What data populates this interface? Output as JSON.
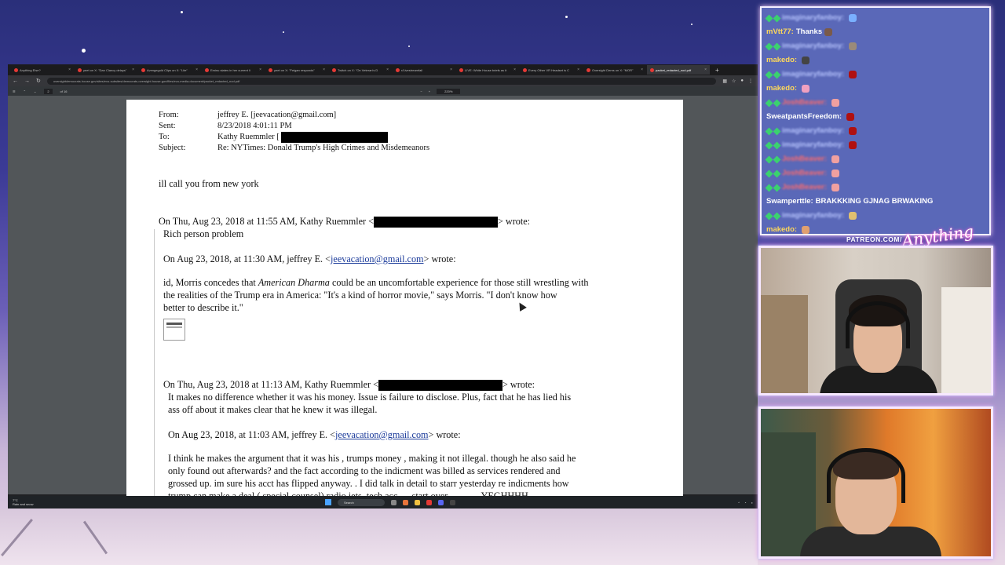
{
  "browser": {
    "tabs": [
      {
        "label": "Anything Else?",
        "active": false
      },
      {
        "label": "yeet on X: \"Dan Clancy delays\"",
        "active": false
      },
      {
        "label": "Avengegold Clips on X: \"Lite\"",
        "active": false
      },
      {
        "label": "Eminu states in her current li",
        "active": false
      },
      {
        "label": "yeet on X: \"Feigan responds\"",
        "active": false
      },
      {
        "label": "Twitch on X: \"On Veteran's D",
        "active": false
      },
      {
        "label": "r/Livestreamfail",
        "active": false
      },
      {
        "label": "LIVE: White House briefs as it",
        "active": false
      },
      {
        "label": "Every Other VR Headset is C",
        "active": false
      },
      {
        "label": "Oversight Dems on X: \"MOR\"",
        "active": false
      },
      {
        "label": "packet_redacted_nod.pdf",
        "active": true
      }
    ],
    "url": "oversightdemocrats.house.gov/sites/evo-subsites/democrats-oversight.house.gov/files/evo-media-document/packet_redacted_nod.pdf",
    "pdf_toolbar": {
      "page_current": "2",
      "page_total": "of 16",
      "zoom": "220%"
    }
  },
  "document": {
    "header": {
      "from_label": "From:",
      "from_value": "jeffrey E. [jeevacation@gmail.com]",
      "sent_label": "Sent:",
      "sent_value": "8/23/2018 4:01:11 PM",
      "to_label": "To:",
      "to_value": "Kathy Ruemmler [",
      "subject_label": "Subject:",
      "subject_value": "Re: NYTimes: Donald Trump's High Crimes and Misdemeanors"
    },
    "body_line": "ill call you from new york",
    "reply1": {
      "intro": "On Thu, Aug 23, 2018 at 11:55 AM, Kathy Ruemmler <",
      "wrote": "> wrote:",
      "text": "Rich person problem"
    },
    "reply2": {
      "intro": "On Aug 23, 2018, at 11:30 AM, jeffrey E. <",
      "email": "jeevacation@gmail.com",
      "wrote": "> wrote:",
      "line1_a": "id, Morris concedes that ",
      "line1_em": "American Dharma",
      "line1_b": " could be an uncomfortable experience for those still wrestling with",
      "line2": "the realities of the Trump era in America: \"It's a kind of horror movie,\" says Morris. \"I don't know how",
      "line3": "better to describe it.\""
    },
    "reply3": {
      "intro": "On Thu, Aug 23, 2018 at 11:13 AM, Kathy Ruemmler <",
      "wrote": "> wrote:",
      "line1": "It makes no difference whether it was his money.   Issue is failure to disclose.  Plus, fact that he has lied his",
      "line2": "ass off about it makes clear that he knew it was illegal."
    },
    "reply4": {
      "intro": "On Aug 23, 2018, at 11:03 AM, jeffrey E. <",
      "email": "jeevacation@gmail.com",
      "wrote": "> wrote:",
      "line1": "I think he makes the argument that it was his , trumps  money  , making it not illegal.    though he also said he",
      "line2": "only found out afterwards?    and the fact according to the indicment was billed as services rendered and",
      "line3": "grossed up.   im sure his acct has flipped anyway.   .   I did talk in detail to starr yesterday re indicments   how",
      "line4": "trump can make a deal  ( special counsel)  radio jets, tech acc, ...  start over ............  YEGHHHH"
    }
  },
  "taskbar": {
    "weather_temp": "7°C",
    "weather_desc": "Rain and snow",
    "search_placeholder": "Search"
  },
  "chat": {
    "messages": [
      {
        "user": "imaginaryfanboy:",
        "text": "",
        "blurred": true,
        "color": "#b9c6ff",
        "emote": "#7ab0ff"
      },
      {
        "user": "mVtt77:",
        "text": "Thanks",
        "blurred": false,
        "color": "#ffd95a",
        "emote": "#7a5a4a"
      },
      {
        "user": "imaginaryfanboy:",
        "text": "",
        "blurred": true,
        "color": "#b9c6ff",
        "emote": "#9a8a7a"
      },
      {
        "user": "makedo:",
        "text": "",
        "blurred": false,
        "color": "#ffd95a",
        "emote": "#444"
      },
      {
        "user": "imaginaryfanboy:",
        "text": "",
        "blurred": true,
        "color": "#b9c6ff",
        "emote": "#b01010"
      },
      {
        "user": "makedo:",
        "text": "",
        "blurred": false,
        "color": "#ffd95a",
        "emote": "#f0a0c0"
      },
      {
        "user": "JoshBeaver:",
        "text": "",
        "blurred": true,
        "color": "#ff6b6b",
        "emote": "#f0a0a0"
      },
      {
        "user": "SweatpantsFreedom:",
        "text": "",
        "blurred": false,
        "color": "#ffffff",
        "emote": "#b01010"
      },
      {
        "user": "imaginaryfanboy:",
        "text": "",
        "blurred": true,
        "color": "#b9c6ff",
        "emote": "#b01010"
      },
      {
        "user": "imaginaryfanboy:",
        "text": "",
        "blurred": true,
        "color": "#b9c6ff",
        "emote": "#b01010"
      },
      {
        "user": "JoshBeaver:",
        "text": "",
        "blurred": true,
        "color": "#ff6b6b",
        "emote": "#f0a0a0"
      },
      {
        "user": "JoshBeaver:",
        "text": "",
        "blurred": true,
        "color": "#ff6b6b",
        "emote": "#f0a0a0"
      },
      {
        "user": "JoshBeaver:",
        "text": "",
        "blurred": true,
        "color": "#ff6b6b",
        "emote": "#f0a0a0"
      },
      {
        "user": "Swamperttle:",
        "text": "BRAKKKING GJNAG BRWAKING",
        "blurred": false,
        "color": "#ffffff",
        "emote": ""
      },
      {
        "user": "imaginaryfanboy:",
        "text": "",
        "blurred": true,
        "color": "#b9c6ff",
        "emote": "#e0c070"
      },
      {
        "user": "makedo:",
        "text": "",
        "blurred": false,
        "color": "#ffd95a",
        "emote": "#e0a070"
      }
    ]
  },
  "overlay": {
    "patreon": "PATREON.COM/",
    "logo": "Anything Else?"
  }
}
